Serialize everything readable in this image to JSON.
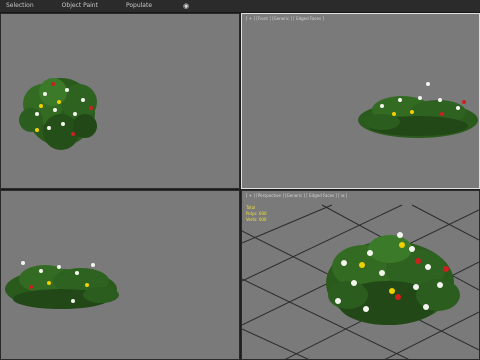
{
  "menubar": {
    "items": [
      "Selection",
      "Object Paint",
      "Populate"
    ],
    "eye_icon": "eye-icon"
  },
  "viewports": {
    "top_left": {
      "label": ""
    },
    "top_right": {
      "label": "[ + ] [Front ] [Generic ] [ Edged Faces ]"
    },
    "bottom_left": {
      "label": ""
    },
    "bottom_right": {
      "label": "[ + ] [Perspective ] [Generic ] [ Edged Faces ] [ ⊞ ]",
      "stats": {
        "total": "Total",
        "polys_label": "Polys:",
        "polys_value": "000",
        "verts_label": "Verts:",
        "verts_value": "000"
      }
    }
  },
  "colors": {
    "viewport_bg": "#7a7a7a",
    "stats_text": "#f1e33a",
    "leaf_dark": "#1e4a15",
    "leaf_light": "#3f7f2c",
    "flower_white": "#f4f4ef",
    "flower_yellow": "#f0d000",
    "flower_red": "#cc1f1f"
  }
}
